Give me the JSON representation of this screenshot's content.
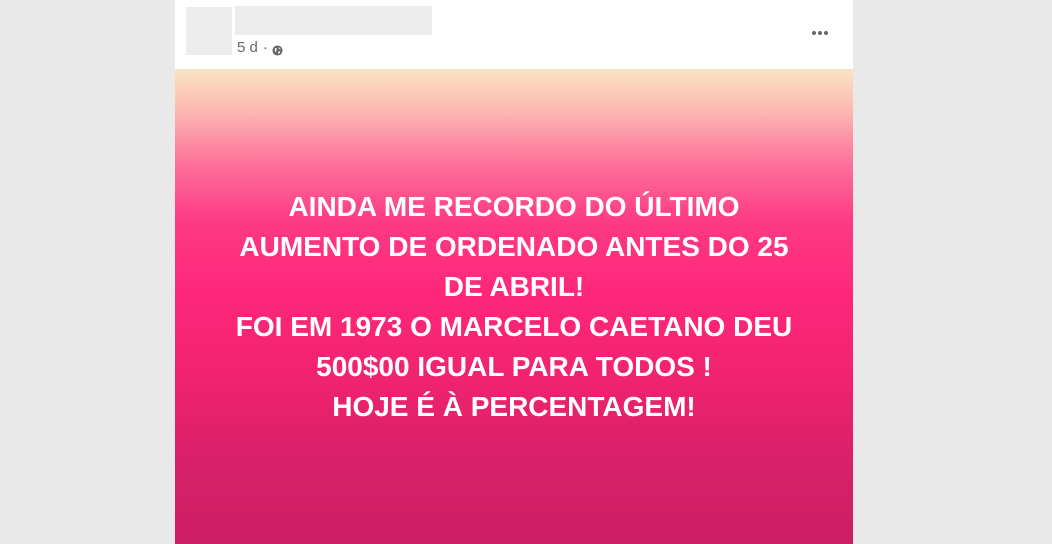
{
  "post": {
    "timestamp": "5 d",
    "separator": "·",
    "privacy_icon": "globe-icon",
    "menu_icon": "more-horizontal-icon",
    "text": "AINDA ME RECORDO DO ÚLTIMO\nAUMENTO DE ORDENADO ANTES DO 25\nDE ABRIL!\nFOI EM 1973 O MARCELO CAETANO DEU\n500$00 IGUAL PARA TODOS !\nHOJE É À PERCENTAGEM!"
  },
  "colors": {
    "page_background": "#e9e9e9",
    "meta_text": "#65676b",
    "post_text": "#ffffff",
    "gradient_top": "#fbe3c4",
    "gradient_mid": "#fe2679",
    "gradient_bottom": "#cc1f63"
  }
}
